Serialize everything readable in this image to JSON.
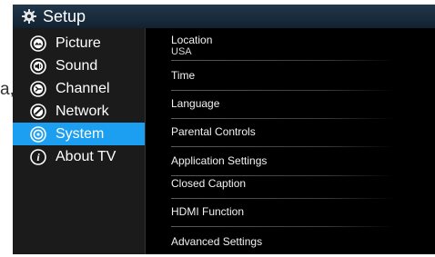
{
  "background_fragment": "a,",
  "header": {
    "title": "Setup",
    "icon": "gear-icon"
  },
  "sidebar": {
    "items": [
      {
        "label": "Picture",
        "icon": "picture-icon",
        "selected": false
      },
      {
        "label": "Sound",
        "icon": "sound-icon",
        "selected": false
      },
      {
        "label": "Channel",
        "icon": "channel-icon",
        "selected": false
      },
      {
        "label": "Network",
        "icon": "network-icon",
        "selected": false
      },
      {
        "label": "System",
        "icon": "system-icon",
        "selected": true
      },
      {
        "label": "About TV",
        "icon": "info-icon",
        "selected": false
      }
    ]
  },
  "menu": {
    "items": [
      {
        "label": "Location",
        "value": "USA"
      },
      {
        "label": "Time"
      },
      {
        "label": "Language"
      },
      {
        "label": "Parental Controls"
      },
      {
        "label": "Application Settings"
      },
      {
        "label": "Closed Caption"
      },
      {
        "label": "HDMI Function"
      },
      {
        "label": "Advanced Settings"
      }
    ]
  },
  "colors": {
    "accent": "#1c9ff0",
    "header_bg": "#1a2d3f",
    "sidebar_bg": "#1b1b1b",
    "content_bg": "#000000"
  }
}
